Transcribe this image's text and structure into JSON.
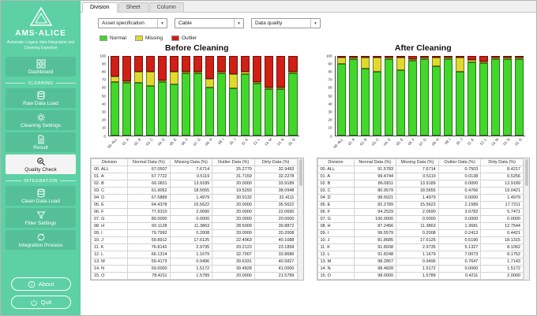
{
  "colors": {
    "sidebar": "#5dd1a4",
    "normal": "#43d62b",
    "missing": "#e0d92e",
    "outlier": "#d01f14"
  },
  "sidebar": {
    "title": "AMS·ALICE",
    "tagline": "Automatic Legacy data Integration and Cleaning Expertise",
    "sections": {
      "cleaning": "CLEANING",
      "integration": "INTEGRATION"
    },
    "items": [
      {
        "label": "Dashboard",
        "icon": "dashboard-icon"
      },
      {
        "label": "Raw Data Load",
        "icon": "database-icon"
      },
      {
        "label": "Cleaning Settings",
        "icon": "gear-icon"
      },
      {
        "label": "Result",
        "icon": "document-icon"
      },
      {
        "label": "Quality Check",
        "icon": "magnifier-check-icon"
      },
      {
        "label": "Clean Data Load",
        "icon": "database-icon"
      },
      {
        "label": "Filter Settings",
        "icon": "funnel-icon"
      },
      {
        "label": "Integration Process",
        "icon": "sync-icon"
      }
    ],
    "about_label": "About",
    "quit_label": "Quit"
  },
  "tabs": [
    {
      "label": "Division",
      "active": true
    },
    {
      "label": "Sheet",
      "active": false
    },
    {
      "label": "Column",
      "active": false
    }
  ],
  "toolbar": {
    "selects": [
      {
        "value": "Asset specification"
      },
      {
        "value": "Cable"
      },
      {
        "value": "Data quality"
      }
    ]
  },
  "legend": [
    {
      "label": "Normal",
      "color": "#43d62b"
    },
    {
      "label": "Missing",
      "color": "#e0d92e"
    },
    {
      "label": "Outlier",
      "color": "#d01f14"
    }
  ],
  "chart_data": [
    {
      "type": "bar",
      "stacked": true,
      "title": "Before Cleaning",
      "ylim": [
        0,
        100
      ],
      "grid": false,
      "categories": [
        "00. ALL",
        "01. A",
        "02. B",
        "03. C",
        "04. D",
        "05. E",
        "06. F",
        "07. G",
        "08. H",
        "09. I",
        "10. J",
        "11. K",
        "12. L",
        "13. M",
        "14. N",
        "15. O"
      ],
      "series": [
        {
          "name": "Normal",
          "color": "#43d62b",
          "values": [
            67.0507,
            67.7722,
            66.0811,
            61.9052,
            67.5889,
            64.4378,
            77.931,
            80.0,
            60.1128,
            79.7992,
            59.8912,
            76.8142,
            66.1314,
            59.4173,
            59.0,
            78.4211
          ]
        },
        {
          "name": "Missing",
          "color": "#e0d92e",
          "values": [
            7.6714,
            0.5119,
            13.9189,
            18.5655,
            1.4979,
            15.5622,
            2.069,
            0.0,
            11.3863,
            0.2008,
            17.6125,
            2.9735,
            1.1679,
            0.9496,
            1.5172,
            1.5789
          ]
        },
        {
          "name": "Outlier",
          "color": "#d01f14",
          "values": [
            25.2779,
            31.7159,
            20.0,
            19.5293,
            30.9132,
            20.0,
            20.0,
            20.0,
            28.5009,
            20.0,
            22.4963,
            20.2123,
            32.7007,
            39.6331,
            39.4828,
            20.0
          ]
        }
      ]
    },
    {
      "type": "bar",
      "stacked": true,
      "title": "After Cleaning",
      "ylim": [
        0,
        100
      ],
      "grid": false,
      "categories": [
        "00. ALL",
        "01. A",
        "02. B",
        "03. C",
        "04. D",
        "05. E",
        "06. F",
        "07. G",
        "08. H",
        "09. I",
        "10. J",
        "11. K",
        "12. L",
        "13. M",
        "14. N",
        "15. O"
      ],
      "series": [
        {
          "name": "Normal",
          "color": "#43d62b",
          "values": [
            91.5783,
            99.4744,
            86.0811,
            80.9579,
            98.5021,
            82.2789,
            94.2529,
            100.0,
            87.2456,
            99.5579,
            81.8685,
            91.8938,
            91.8248,
            98.2857,
            98.4828,
            98.0
          ]
        },
        {
          "name": "Missing",
          "color": "#e0d92e",
          "values": [
            7.6714,
            0.5119,
            13.9189,
            18.5655,
            1.4979,
            15.5622,
            2.069,
            0.0,
            11.3863,
            0.2008,
            17.6125,
            2.9735,
            1.1679,
            0.9496,
            1.5172,
            1.5789
          ]
        },
        {
          "name": "Outlier",
          "color": "#d01f14",
          "values": [
            0.7503,
            0.0138,
            0.0,
            0.4766,
            0.0,
            2.1589,
            3.6782,
            0.0,
            1.3681,
            0.2413,
            0.519,
            5.1327,
            7.0073,
            0.7647,
            0.0,
            0.4211
          ]
        }
      ]
    }
  ],
  "tables": {
    "headers": [
      "Division",
      "Normal Data (%)",
      "Missing Data (%)",
      "Outlier Data (%)",
      "Dirty Data (%)"
    ],
    "before_rows": [
      [
        "00. ALL",
        "67.0507",
        "7.6714",
        "25.2779",
        "32.9493"
      ],
      [
        "01. A",
        "67.7722",
        "0.5119",
        "31.7159",
        "32.2278"
      ],
      [
        "02. B",
        "66.0811",
        "13.9189",
        "20.0000",
        "33.9189"
      ],
      [
        "03. C",
        "61.9052",
        "18.5655",
        "19.5293",
        "38.0948"
      ],
      [
        "04. D",
        "67.5889",
        "1.4979",
        "30.9132",
        "32.4111"
      ],
      [
        "05. E",
        "64.4378",
        "15.5622",
        "20.0000",
        "35.5622"
      ],
      [
        "06. F",
        "77.9310",
        "2.0690",
        "20.0000",
        "22.0690"
      ],
      [
        "07. G",
        "80.0000",
        "0.0000",
        "20.0000",
        "20.0000"
      ],
      [
        "08. H",
        "60.1128",
        "11.3863",
        "28.5009",
        "39.8872"
      ],
      [
        "09. I",
        "79.7992",
        "0.2008",
        "20.0000",
        "20.2008"
      ],
      [
        "10. J",
        "59.8912",
        "17.6125",
        "22.4963",
        "40.1088"
      ],
      [
        "11. K",
        "76.8142",
        "2.9735",
        "20.2123",
        "23.1858"
      ],
      [
        "12. L",
        "66.1314",
        "1.1679",
        "32.7007",
        "33.8686"
      ],
      [
        "13. M",
        "59.4173",
        "0.9496",
        "39.6331",
        "40.5827"
      ],
      [
        "14. N",
        "59.0000",
        "1.5172",
        "39.4828",
        "41.0000"
      ],
      [
        "15. O",
        "78.4211",
        "1.5789",
        "20.0000",
        "21.5789"
      ]
    ],
    "after_rows": [
      [
        "00. ALL",
        "91.5783",
        "7.6714",
        "0.7503",
        "8.4217"
      ],
      [
        "01. A",
        "99.4744",
        "0.5119",
        "0.0138",
        "0.5256"
      ],
      [
        "02. B",
        "86.0811",
        "13.9189",
        "0.0000",
        "13.9189"
      ],
      [
        "03. C",
        "80.9579",
        "18.5655",
        "0.4766",
        "19.0421"
      ],
      [
        "04. D",
        "98.5021",
        "1.4979",
        "0.0000",
        "1.4979"
      ],
      [
        "05. E",
        "82.2789",
        "15.5622",
        "2.1589",
        "17.7211"
      ],
      [
        "06. F",
        "94.2529",
        "2.0690",
        "3.6782",
        "5.7471"
      ],
      [
        "07. G",
        "100.0000",
        "0.0000",
        "0.0000",
        "0.0000"
      ],
      [
        "08. H",
        "87.2456",
        "11.3863",
        "1.3681",
        "12.7544"
      ],
      [
        "09. I",
        "99.5579",
        "0.2008",
        "0.2413",
        "0.4421"
      ],
      [
        "10. J",
        "81.8685",
        "17.6125",
        "0.5190",
        "18.1315"
      ],
      [
        "11. K",
        "91.8938",
        "2.9735",
        "5.1327",
        "8.1062"
      ],
      [
        "12. L",
        "91.8248",
        "1.1679",
        "7.0073",
        "8.1752"
      ],
      [
        "13. M",
        "98.2857",
        "0.9496",
        "0.7647",
        "1.7143"
      ],
      [
        "14. N",
        "98.4828",
        "1.5172",
        "0.0000",
        "1.5172"
      ],
      [
        "15. O",
        "98.0000",
        "1.5789",
        "0.4211",
        "2.0000"
      ]
    ]
  }
}
